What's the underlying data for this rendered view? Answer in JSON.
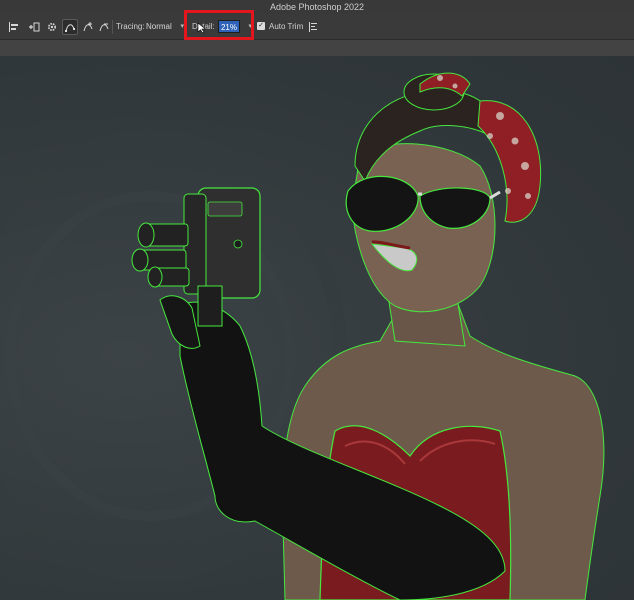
{
  "window": {
    "title": "Adobe Photoshop 2022"
  },
  "options_bar": {
    "tracing_label": "Tracing:",
    "tracing_value": "Normal",
    "detail_label": "Detail:",
    "detail_value": "21%",
    "auto_trim_label": "Auto Trim",
    "auto_trim_checked": true
  },
  "colors": {
    "highlight": "#e4161d",
    "selection_outline": "#46e83e",
    "detail_field": "#2d62b8"
  },
  "icons": [
    "align-left-icon",
    "add-to-path-icon",
    "gear-icon",
    "path-mode-icon",
    "path-add-icon",
    "path-subtract-icon",
    "arrow-cursor-icon",
    "path-options-icon"
  ]
}
